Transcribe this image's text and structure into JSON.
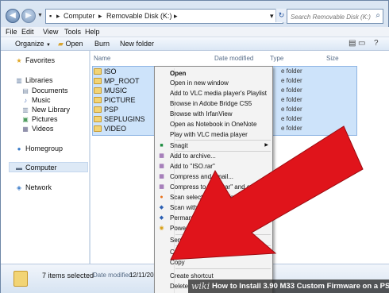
{
  "window": {
    "address_crumbs": [
      "Computer",
      "Removable Disk (K:)"
    ],
    "search_placeholder": "Search Removable Disk (K:)"
  },
  "menubar": [
    "File",
    "Edit",
    "View",
    "Tools",
    "Help"
  ],
  "toolbar": {
    "organize": "Organize",
    "open": "Open",
    "burn": "Burn",
    "new_folder": "New folder"
  },
  "nav": {
    "favorites": "Favorites",
    "libraries": "Libraries",
    "library_items": [
      "Documents",
      "Music",
      "New Library",
      "Pictures",
      "Videos"
    ],
    "homegroup": "Homegroup",
    "computer": "Computer",
    "network": "Network"
  },
  "columns": {
    "name": "Name",
    "date": "Date modified",
    "type": "Type",
    "size": "Size"
  },
  "files": [
    {
      "name": "ISO",
      "type": "e folder"
    },
    {
      "name": "MP_ROOT",
      "type": "e folder"
    },
    {
      "name": "MUSIC",
      "type": "e folder"
    },
    {
      "name": "PICTURE",
      "type": "e folder"
    },
    {
      "name": "PSP",
      "type": "e folder"
    },
    {
      "name": "SEPLUGINS",
      "type": "e folder"
    },
    {
      "name": "VIDEO",
      "type": "e folder"
    }
  ],
  "context_menu": [
    {
      "label": "Open",
      "icon": ""
    },
    {
      "label": "Open in new window",
      "icon": ""
    },
    {
      "label": "Add to VLC media player's Playlist",
      "icon": ""
    },
    {
      "label": "Browse in Adobe Bridge CS5",
      "icon": ""
    },
    {
      "label": "Browse with IrfanView",
      "icon": ""
    },
    {
      "label": "Open as Notebook in OneNote",
      "icon": ""
    },
    {
      "label": "Play with VLC media player",
      "icon": ""
    },
    {
      "label": "Snagit",
      "icon": "snagit-icon"
    },
    {
      "label": "Add to archive...",
      "icon": "winrar-icon"
    },
    {
      "label": "Add to \"ISO.rar\"",
      "icon": "winrar-icon"
    },
    {
      "label": "Compress and email...",
      "icon": "winrar-icon"
    },
    {
      "label": "Compress to \"ISO.rar\" and email",
      "icon": "winrar-icon"
    },
    {
      "label": "Scan selected items for viruses",
      "icon": "avast-icon"
    },
    {
      "label": "Scan with AVG",
      "icon": "avg-icon"
    },
    {
      "label": "Permanently shred with AVG",
      "icon": "avg-icon"
    },
    {
      "label": "PowerISO",
      "icon": "poweriso-icon"
    },
    {
      "label": "Send to",
      "icon": ""
    },
    {
      "label": "Cut",
      "icon": ""
    },
    {
      "label": "Copy",
      "icon": ""
    },
    {
      "label": "Create shortcut",
      "icon": ""
    },
    {
      "label": "Delete",
      "icon": ""
    }
  ],
  "status": {
    "count": "7 items selected",
    "date_label": "Date modified:",
    "date_value": "12/11/201"
  },
  "caption": {
    "logo": "wiki",
    "text": "How to Install 3.90 M33 Custom Firmware on a PSP"
  },
  "colors": {
    "arrow": "#e0141b",
    "selection": "#cde3fa"
  }
}
